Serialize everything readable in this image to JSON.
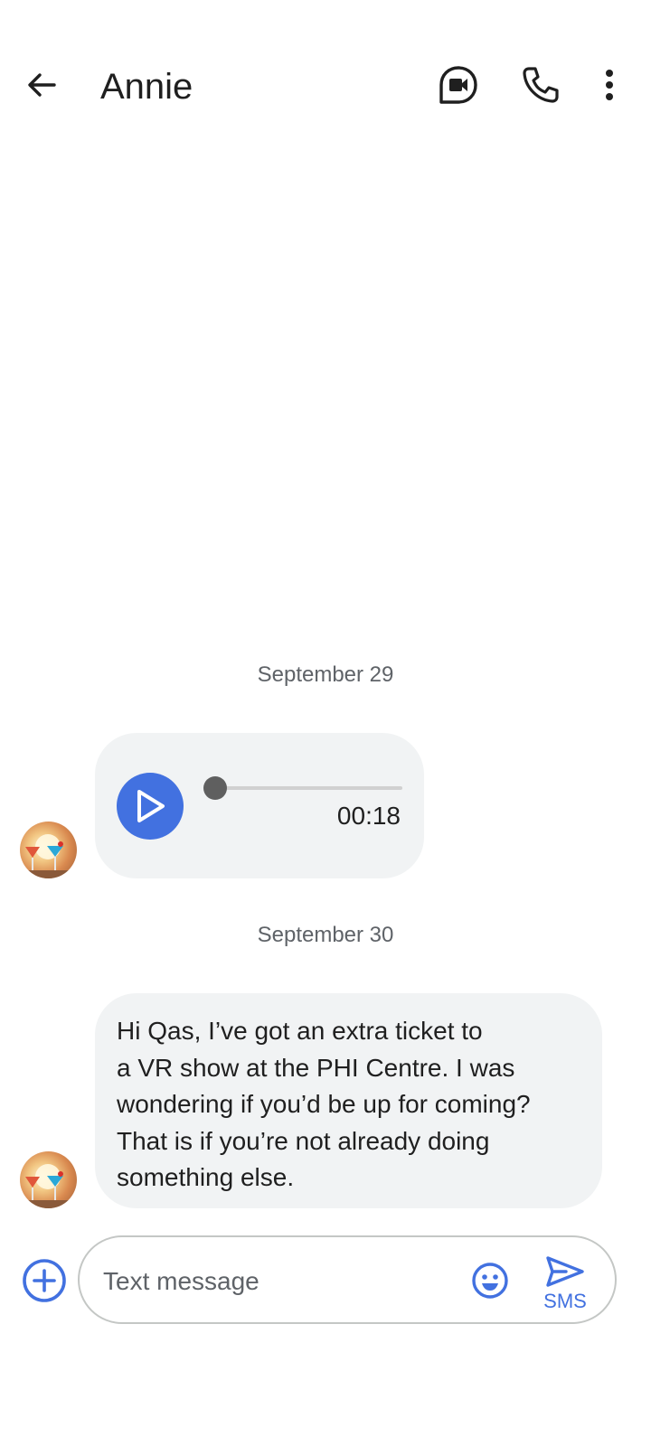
{
  "header": {
    "title": "Annie",
    "back_icon": "arrow-back-icon",
    "video_icon": "video-call-icon",
    "call_icon": "phone-icon",
    "more_icon": "more-vert-icon"
  },
  "conversation": {
    "groups": [
      {
        "date": "September 29",
        "message": {
          "type": "audio",
          "duration": "00:18",
          "progress": 0
        }
      },
      {
        "date": "September 30",
        "message": {
          "type": "text",
          "text": "Hi Qas, I’ve got an extra ticket to\na VR show at the PHI Centre. I was\nwondering if you’d be up for coming?\nThat is if you’re not already doing\nsomething else."
        }
      }
    ]
  },
  "composer": {
    "placeholder": "Text message",
    "value": "",
    "send_label": "SMS",
    "add_icon": "add-circle-icon",
    "emoji_icon": "emoji-icon",
    "send_icon": "send-icon"
  },
  "colors": {
    "accent": "#4271e0",
    "bubble": "#f1f3f4",
    "secondary_text": "#5f6368",
    "primary_text": "#1f1f1f"
  }
}
